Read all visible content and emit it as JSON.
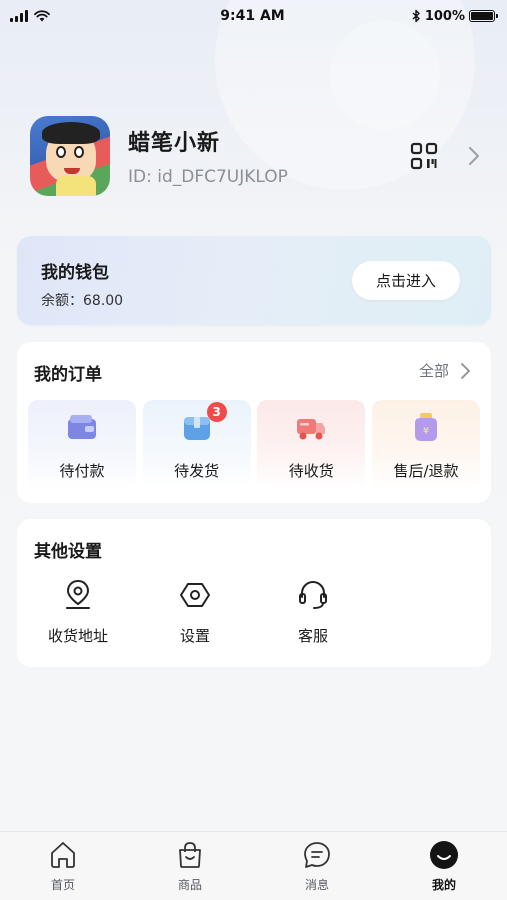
{
  "status_bar": {
    "time": "9:41 AM",
    "battery": "100%",
    "battery_level": 1.0
  },
  "profile": {
    "name": "蜡笔小新",
    "id_text": "ID: id_DFC7UJKLOP",
    "avatar_icon": "avatar-cartoon",
    "qr_icon": "qr-code-icon"
  },
  "wallet": {
    "title": "我的钱包",
    "balance": "余额：68.00",
    "enter_label": "点击进入"
  },
  "orders": {
    "title": "我的订单",
    "all_label": "全部",
    "items": [
      {
        "label": "待付款",
        "icon": "wallet-icon",
        "badge": ""
      },
      {
        "label": "待发货",
        "icon": "package-icon",
        "badge": "3"
      },
      {
        "label": "待收货",
        "icon": "truck-icon",
        "badge": ""
      },
      {
        "label": "售后/退款",
        "icon": "refund-bag-icon",
        "badge": ""
      }
    ]
  },
  "settings": {
    "title": "其他设置",
    "items": [
      {
        "label": "收货地址",
        "icon": "location-pin-icon"
      },
      {
        "label": "设置",
        "icon": "hexagon-gear-icon"
      },
      {
        "label": "客服",
        "icon": "headset-icon"
      }
    ]
  },
  "tabbar": {
    "tabs": [
      {
        "label": "首页",
        "icon": "home-icon",
        "active": false
      },
      {
        "label": "商品",
        "icon": "shopping-bag-icon",
        "active": false
      },
      {
        "label": "消息",
        "icon": "message-icon",
        "active": false
      },
      {
        "label": "我的",
        "icon": "profile-icon",
        "active": true
      }
    ]
  },
  "colors": {
    "badge": "#ef4b4b",
    "page_bg": "#f4f5f7",
    "card_bg": "#ffffff",
    "wallet_bg": "#e2eaf7"
  }
}
